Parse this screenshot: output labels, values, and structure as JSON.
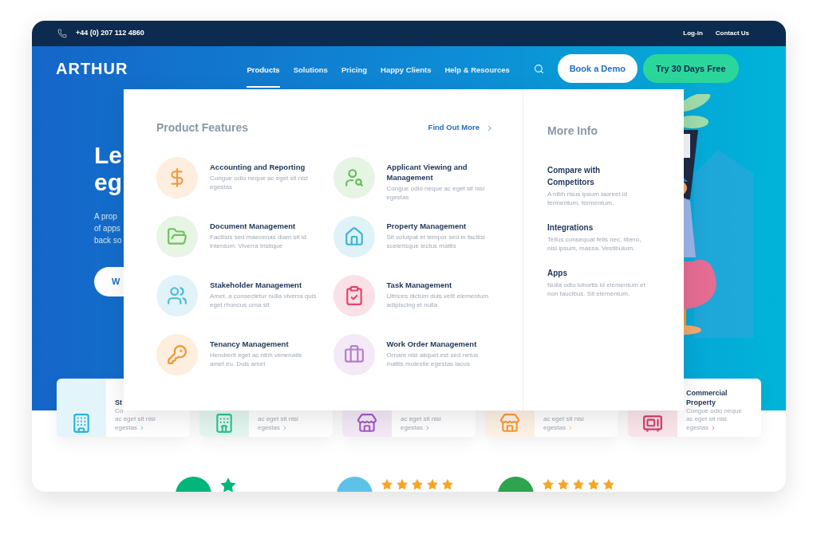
{
  "top_bar": {
    "phone": "+44 (0) 207 112 4860",
    "links": [
      "Log-in",
      "Contact Us"
    ]
  },
  "header": {
    "brand": "ARTHUR",
    "nav": [
      {
        "label": "Products",
        "selected": true
      },
      {
        "label": "Solutions",
        "selected": false
      },
      {
        "label": "Pricing",
        "selected": false
      },
      {
        "label": "Happy Clients",
        "selected": false
      },
      {
        "label": "Help & Resources",
        "selected": false
      }
    ],
    "demo_button": "Book a Demo",
    "trial_button": "Try 30 Days Free"
  },
  "hero": {
    "heading_lines": [
      "Le",
      "eg"
    ],
    "text_lines": [
      "A prop",
      "of apps",
      "back so"
    ],
    "button": "W"
  },
  "dropdown": {
    "title": "Product Features",
    "link": "Find Out More",
    "features": [
      {
        "title": "Accounting and Reporting",
        "text": "Congue odio neque ac eget sit nisi egestas",
        "color": "#f39a3c"
      },
      {
        "title": "Applicant Viewing and Management",
        "text": "Congue odio neque ac eget sit nisi egestas",
        "color": "#62bf55"
      },
      {
        "title": "Document Management",
        "text": "Facilisis sed maecenas diam sit id interdum. Viverra tristique",
        "color": "#6cc25a"
      },
      {
        "title": "Property Management",
        "text": "Sit volutpat et tempor sed in facilisi scelerisque lectus mattis",
        "color": "#3fb3d6"
      },
      {
        "title": "Stakeholder Management",
        "text": "Amet, a consectetur nulla viverra quis eget rhoncus urna sit",
        "color": "#4bb8d8"
      },
      {
        "title": "Task Management",
        "text": "Ultrices dictum duis velit elementum adipiscing et nulla",
        "color": "#e2426f"
      },
      {
        "title": "Tenancy Management",
        "text": "Hendrerit eget ac nibh venenatis amet eu. Duis amet",
        "color": "#f0962f"
      },
      {
        "title": "Work Order Management",
        "text": "Ornare nisi aliquet est sed netus mattis molestie egestas lacus",
        "color": "#b57ccc"
      }
    ],
    "more_title": "More Info",
    "more": [
      {
        "title": "Compare with Competitors",
        "text": "A nibh risus ipsum laoreet id fermentum, fermentum."
      },
      {
        "title": "Integrations",
        "text": "Tellus consequat felis nec, libero, nisl ipsum, massa. Vestibulum."
      },
      {
        "title": "Apps",
        "text": "Nulla odio lobortis id elementum et non faucibus. Sit elementum."
      }
    ]
  },
  "cards": [
    {
      "title_lines": [
        "St"
      ],
      "text_lines": [
        "Co",
        "ac eget sit nisi",
        "egestas"
      ],
      "color": "#2ab4d6"
    },
    {
      "text_lines": [
        "ac eget sit nisi",
        "egestas"
      ],
      "color": "#2fc48f"
    },
    {
      "text_lines": [
        "ac eget sit nisi",
        "egestas"
      ],
      "color": "#a35cc4"
    },
    {
      "text_lines": [
        "ac eget sit nisi",
        "egestas"
      ],
      "color": "#f59a3a"
    },
    {
      "title_lines": [
        "Commercial",
        "Property"
      ],
      "text_lines": [
        "Congue odio neque",
        "ac eget sit nisi",
        "egestas"
      ],
      "color": "#d63b6a"
    }
  ],
  "ratings": [
    {
      "kind": "logo",
      "color": "#00b67a"
    },
    {
      "kind": "stars",
      "color": "#5ec2e8",
      "stars": 5
    },
    {
      "kind": "stars",
      "color": "#2ea44f",
      "stars": 5
    }
  ]
}
